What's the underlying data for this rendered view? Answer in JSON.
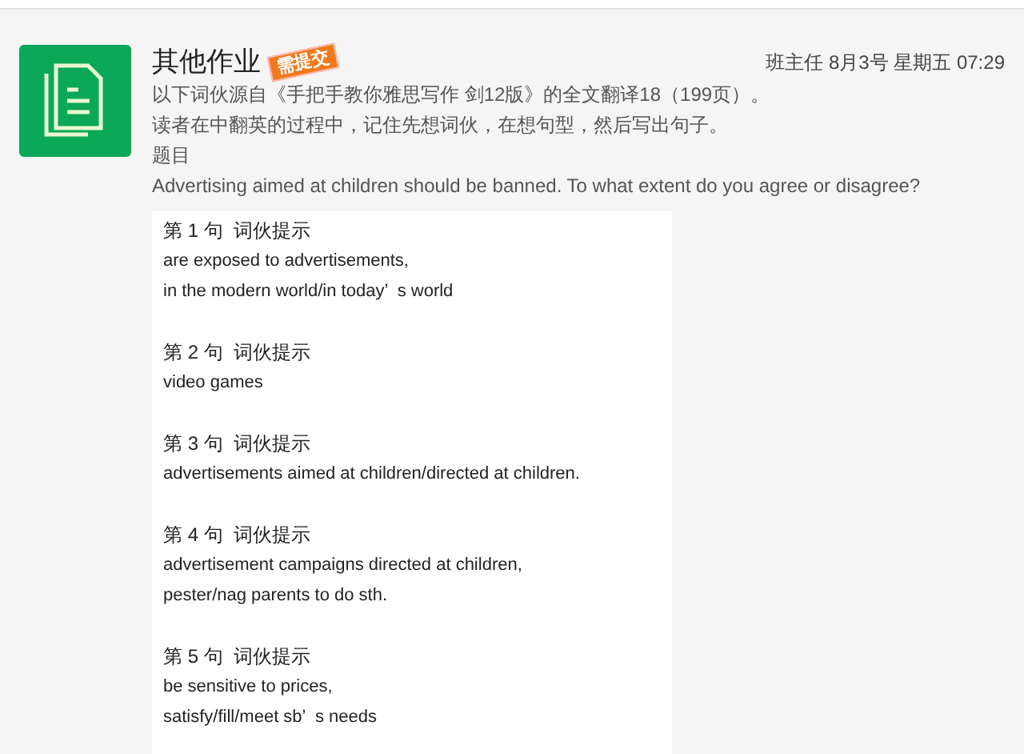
{
  "post": {
    "title": "其他作业",
    "badge": "需提交",
    "meta": "班主任 8月3号 星期五 07:29",
    "lines": [
      "以下词伙源自《手把手教你雅思写作 剑12版》的全文翻译18（199页）。",
      "读者在中翻英的过程中，记住先想词伙，在想句型，然后写出句子。",
      "题目",
      "Advertising aimed at children should be banned. To what extent do you agree or disagree?"
    ]
  },
  "hints": [
    {
      "heading": "第 1 句  词伙提示",
      "lines": [
        "are exposed to advertisements,",
        "in the modern world/in today’  s world"
      ]
    },
    {
      "heading": "第 2 句  词伙提示",
      "lines": [
        "video games"
      ]
    },
    {
      "heading": "第 3 句  词伙提示",
      "lines": [
        "advertisements aimed at children/directed at children."
      ]
    },
    {
      "heading": "第 4 句  词伙提示",
      "lines": [
        "advertisement campaigns directed at children,",
        "pester/nag parents to do sth."
      ]
    },
    {
      "heading": "第 5 句  词伙提示",
      "lines": [
        "be sensitive to prices,",
        "satisfy/fill/meet sb’  s needs"
      ]
    }
  ]
}
